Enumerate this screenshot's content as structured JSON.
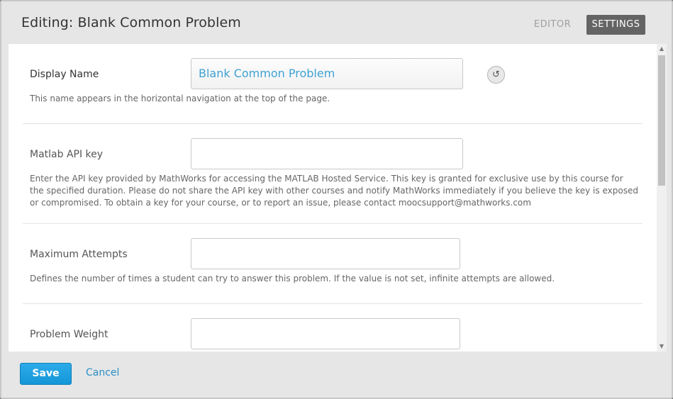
{
  "modal": {
    "title": "Editing: Blank Common Problem",
    "tabs": [
      {
        "label": "EDITOR",
        "active": false
      },
      {
        "label": "SETTINGS",
        "active": true
      }
    ]
  },
  "fields": [
    {
      "label": "Display Name",
      "value": "Blank Common Problem",
      "help": "This name appears in the horizontal navigation at the top of the page.",
      "has_revert": true
    },
    {
      "label": "Matlab API key",
      "value": "",
      "help": "Enter the API key provided by MathWorks for accessing the MATLAB Hosted Service. This key is granted for exclusive use by this course for the specified duration. Please do not share the API key with other courses and notify MathWorks immediately if you believe the key is exposed or compromised. To obtain a key for your course, or to report an issue, please contact moocsupport@mathworks.com"
    },
    {
      "label": "Maximum Attempts",
      "value": "",
      "help": "Defines the number of times a student can try to answer this problem. If the value is not set, infinite attempts are allowed."
    },
    {
      "label": "Problem Weight",
      "value": "",
      "help": ""
    }
  ],
  "footer": {
    "save_label": "Save",
    "cancel_label": "Cancel"
  },
  "colors": {
    "accent": "#1496d8",
    "link": "#2a8fc7",
    "active_tab": "#646464"
  },
  "icons": {
    "revert": "revert-icon",
    "scroll_up": "scroll-up-icon",
    "scroll_down": "scroll-down-icon"
  }
}
